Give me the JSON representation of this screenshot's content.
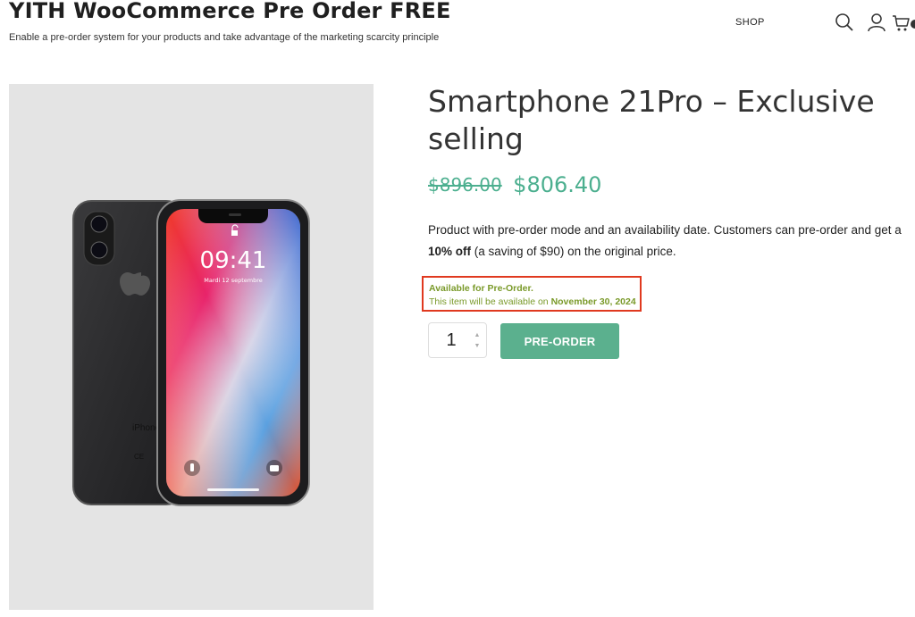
{
  "site": {
    "title": "YITH WooCommerce Pre Order FREE",
    "tagline": "Enable a pre-order system for your products and take advantage of the marketing scarcity principle"
  },
  "nav": {
    "shop_label": "SHOP",
    "icons": [
      "search-icon",
      "user-icon",
      "cart-icon"
    ]
  },
  "product": {
    "title": "Smartphone 21Pro – Exclusive selling",
    "price_old": "$896.00",
    "price_new": "$806.40",
    "description": {
      "part1": "Product with pre-order mode and an availability date.  Customers can pre-order and get a ",
      "bold": "10% off",
      "part2": " (a saving of $90) on the original price."
    },
    "preorder": {
      "label": "Available for Pre-Order.",
      "date_prefix": "This item will be available on ",
      "date": "November 30, 2024"
    },
    "quantity": "1",
    "button_label": "PRE-ORDER",
    "image": {
      "lock_time": "09:41",
      "lock_date": "Mardi 12 septembre",
      "back_text": "iPhone",
      "back_marks": "CE"
    }
  },
  "colors": {
    "accent_green": "#5bb08e",
    "price_green": "#4caf8f",
    "notice_green": "#7a9a2a",
    "highlight_red": "#e0391f",
    "image_background": "#e4e4e4"
  }
}
